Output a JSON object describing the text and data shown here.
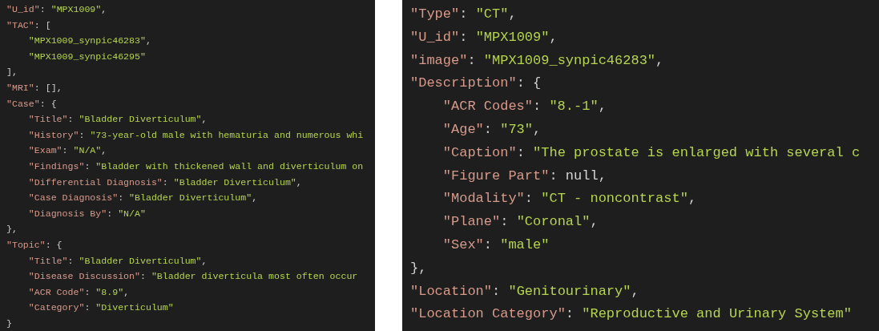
{
  "panels": [
    {
      "lines": [
        {
          "tokens": [
            {
              "kind": "key",
              "text": "\"U_id\""
            },
            {
              "kind": "punct",
              "text": ": "
            },
            {
              "kind": "string",
              "text": "\"MPX1009\""
            },
            {
              "kind": "punct",
              "text": ","
            }
          ]
        },
        {
          "tokens": [
            {
              "kind": "key",
              "text": "\"TAC\""
            },
            {
              "kind": "punct",
              "text": ": ["
            }
          ],
          "children": [
            {
              "tokens": [
                {
                  "kind": "string",
                  "text": "\"MPX1009_synpic46283\""
                },
                {
                  "kind": "punct",
                  "text": ","
                }
              ]
            },
            {
              "tokens": [
                {
                  "kind": "string",
                  "text": "\"MPX1009_synpic46295\""
                }
              ]
            }
          ]
        },
        {
          "tokens": [
            {
              "kind": "punct",
              "text": "],"
            }
          ]
        },
        {
          "tokens": [
            {
              "kind": "key",
              "text": "\"MRI\""
            },
            {
              "kind": "punct",
              "text": ": [],"
            }
          ]
        },
        {
          "tokens": [
            {
              "kind": "key",
              "text": "\"Case\""
            },
            {
              "kind": "punct",
              "text": ": {"
            }
          ],
          "children": [
            {
              "tokens": [
                {
                  "kind": "key",
                  "text": "\"Title\""
                },
                {
                  "kind": "punct",
                  "text": ": "
                },
                {
                  "kind": "string",
                  "text": "\"Bladder Diverticulum\""
                },
                {
                  "kind": "punct",
                  "text": ","
                }
              ]
            },
            {
              "tokens": [
                {
                  "kind": "key",
                  "text": "\"History\""
                },
                {
                  "kind": "punct",
                  "text": ": "
                },
                {
                  "kind": "string",
                  "text": "\"73-year-old male with hematuria and numerous whi"
                }
              ]
            },
            {
              "tokens": [
                {
                  "kind": "key",
                  "text": "\"Exam\""
                },
                {
                  "kind": "punct",
                  "text": ": "
                },
                {
                  "kind": "string",
                  "text": "\"N/A\""
                },
                {
                  "kind": "punct",
                  "text": ","
                }
              ]
            },
            {
              "tokens": [
                {
                  "kind": "key",
                  "text": "\"Findings\""
                },
                {
                  "kind": "punct",
                  "text": ": "
                },
                {
                  "kind": "string",
                  "text": "\"Bladder with thickened wall and diverticulum on"
                }
              ]
            },
            {
              "tokens": [
                {
                  "kind": "key",
                  "text": "\"Differential Diagnosis\""
                },
                {
                  "kind": "punct",
                  "text": ": "
                },
                {
                  "kind": "string",
                  "text": "\"Bladder Diverticulum\""
                },
                {
                  "kind": "punct",
                  "text": ","
                }
              ]
            },
            {
              "tokens": [
                {
                  "kind": "key",
                  "text": "\"Case Diagnosis\""
                },
                {
                  "kind": "punct",
                  "text": ": "
                },
                {
                  "kind": "string",
                  "text": "\"Bladder Diverticulum\""
                },
                {
                  "kind": "punct",
                  "text": ","
                }
              ]
            },
            {
              "tokens": [
                {
                  "kind": "key",
                  "text": "\"Diagnosis By\""
                },
                {
                  "kind": "punct",
                  "text": ": "
                },
                {
                  "kind": "string",
                  "text": "\"N/A\""
                }
              ]
            }
          ]
        },
        {
          "tokens": [
            {
              "kind": "punct",
              "text": "},"
            }
          ]
        },
        {
          "tokens": [
            {
              "kind": "key",
              "text": "\"Topic\""
            },
            {
              "kind": "punct",
              "text": ": {"
            }
          ],
          "children": [
            {
              "tokens": [
                {
                  "kind": "key",
                  "text": "\"Title\""
                },
                {
                  "kind": "punct",
                  "text": ": "
                },
                {
                  "kind": "string",
                  "text": "\"Bladder Diverticulum\""
                },
                {
                  "kind": "punct",
                  "text": ","
                }
              ]
            },
            {
              "tokens": [
                {
                  "kind": "key",
                  "text": "\"Disease Discussion\""
                },
                {
                  "kind": "punct",
                  "text": ": "
                },
                {
                  "kind": "string",
                  "text": "\"Bladder diverticula most often occur"
                }
              ]
            },
            {
              "tokens": [
                {
                  "kind": "key",
                  "text": "\"ACR Code\""
                },
                {
                  "kind": "punct",
                  "text": ": "
                },
                {
                  "kind": "string",
                  "text": "\"8.9\""
                },
                {
                  "kind": "punct",
                  "text": ","
                }
              ]
            },
            {
              "tokens": [
                {
                  "kind": "key",
                  "text": "\"Category\""
                },
                {
                  "kind": "punct",
                  "text": ": "
                },
                {
                  "kind": "string",
                  "text": "\"Diverticulum\""
                }
              ]
            }
          ]
        },
        {
          "tokens": [
            {
              "kind": "punct",
              "text": "}"
            }
          ]
        }
      ]
    },
    {
      "lines": [
        {
          "tokens": [
            {
              "kind": "key",
              "text": "\"Type\""
            },
            {
              "kind": "punct",
              "text": ": "
            },
            {
              "kind": "string",
              "text": "\"CT\""
            },
            {
              "kind": "punct",
              "text": ","
            }
          ]
        },
        {
          "tokens": [
            {
              "kind": "key",
              "text": "\"U_id\""
            },
            {
              "kind": "punct",
              "text": ": "
            },
            {
              "kind": "string",
              "text": "\"MPX1009\""
            },
            {
              "kind": "punct",
              "text": ","
            }
          ]
        },
        {
          "tokens": [
            {
              "kind": "key",
              "text": "\"image\""
            },
            {
              "kind": "punct",
              "text": ": "
            },
            {
              "kind": "string",
              "text": "\"MPX1009_synpic46283\""
            },
            {
              "kind": "punct",
              "text": ","
            }
          ]
        },
        {
          "tokens": [
            {
              "kind": "key",
              "text": "\"Description\""
            },
            {
              "kind": "punct",
              "text": ": {"
            }
          ],
          "children": [
            {
              "tokens": [
                {
                  "kind": "key",
                  "text": "\"ACR Codes\""
                },
                {
                  "kind": "punct",
                  "text": ": "
                },
                {
                  "kind": "string",
                  "text": "\"8.-1\""
                },
                {
                  "kind": "punct",
                  "text": ","
                }
              ]
            },
            {
              "tokens": [
                {
                  "kind": "key",
                  "text": "\"Age\""
                },
                {
                  "kind": "punct",
                  "text": ": "
                },
                {
                  "kind": "string",
                  "text": "\"73\""
                },
                {
                  "kind": "punct",
                  "text": ","
                }
              ]
            },
            {
              "tokens": [
                {
                  "kind": "key",
                  "text": "\"Caption\""
                },
                {
                  "kind": "punct",
                  "text": ": "
                },
                {
                  "kind": "string",
                  "text": "\"The prostate is enlarged with several c"
                }
              ]
            },
            {
              "tokens": [
                {
                  "kind": "key",
                  "text": "\"Figure Part\""
                },
                {
                  "kind": "punct",
                  "text": ": "
                },
                {
                  "kind": "literal",
                  "text": "null"
                },
                {
                  "kind": "punct",
                  "text": ","
                }
              ]
            },
            {
              "tokens": [
                {
                  "kind": "key",
                  "text": "\"Modality\""
                },
                {
                  "kind": "punct",
                  "text": ": "
                },
                {
                  "kind": "string",
                  "text": "\"CT - noncontrast\""
                },
                {
                  "kind": "punct",
                  "text": ","
                }
              ]
            },
            {
              "tokens": [
                {
                  "kind": "key",
                  "text": "\"Plane\""
                },
                {
                  "kind": "punct",
                  "text": ": "
                },
                {
                  "kind": "string",
                  "text": "\"Coronal\""
                },
                {
                  "kind": "punct",
                  "text": ","
                }
              ]
            },
            {
              "tokens": [
                {
                  "kind": "key",
                  "text": "\"Sex\""
                },
                {
                  "kind": "punct",
                  "text": ": "
                },
                {
                  "kind": "string",
                  "text": "\"male\""
                }
              ]
            }
          ]
        },
        {
          "tokens": [
            {
              "kind": "punct",
              "text": "},"
            }
          ]
        },
        {
          "tokens": [
            {
              "kind": "key",
              "text": "\"Location\""
            },
            {
              "kind": "punct",
              "text": ": "
            },
            {
              "kind": "string",
              "text": "\"Genitourinary\""
            },
            {
              "kind": "punct",
              "text": ","
            }
          ]
        },
        {
          "tokens": [
            {
              "kind": "key",
              "text": "\"Location Category\""
            },
            {
              "kind": "punct",
              "text": ": "
            },
            {
              "kind": "string",
              "text": "\"Reproductive and Urinary System\""
            }
          ]
        }
      ]
    }
  ]
}
